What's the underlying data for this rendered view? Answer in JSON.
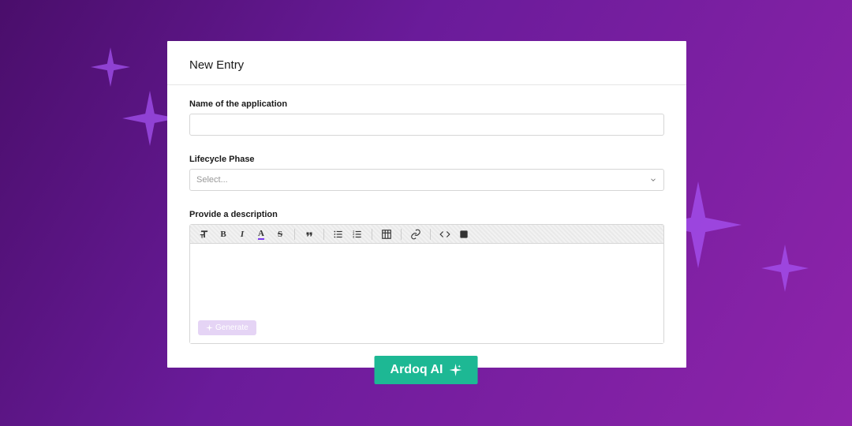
{
  "header": {
    "title": "New Entry"
  },
  "form": {
    "name_label": "Name of the application",
    "name_value": "",
    "phase_label": "Lifecycle Phase",
    "phase_placeholder": "Select...",
    "desc_label": "Provide a description",
    "generate_label": "Generate"
  },
  "ai_badge": {
    "label": "Ardoq AI"
  }
}
